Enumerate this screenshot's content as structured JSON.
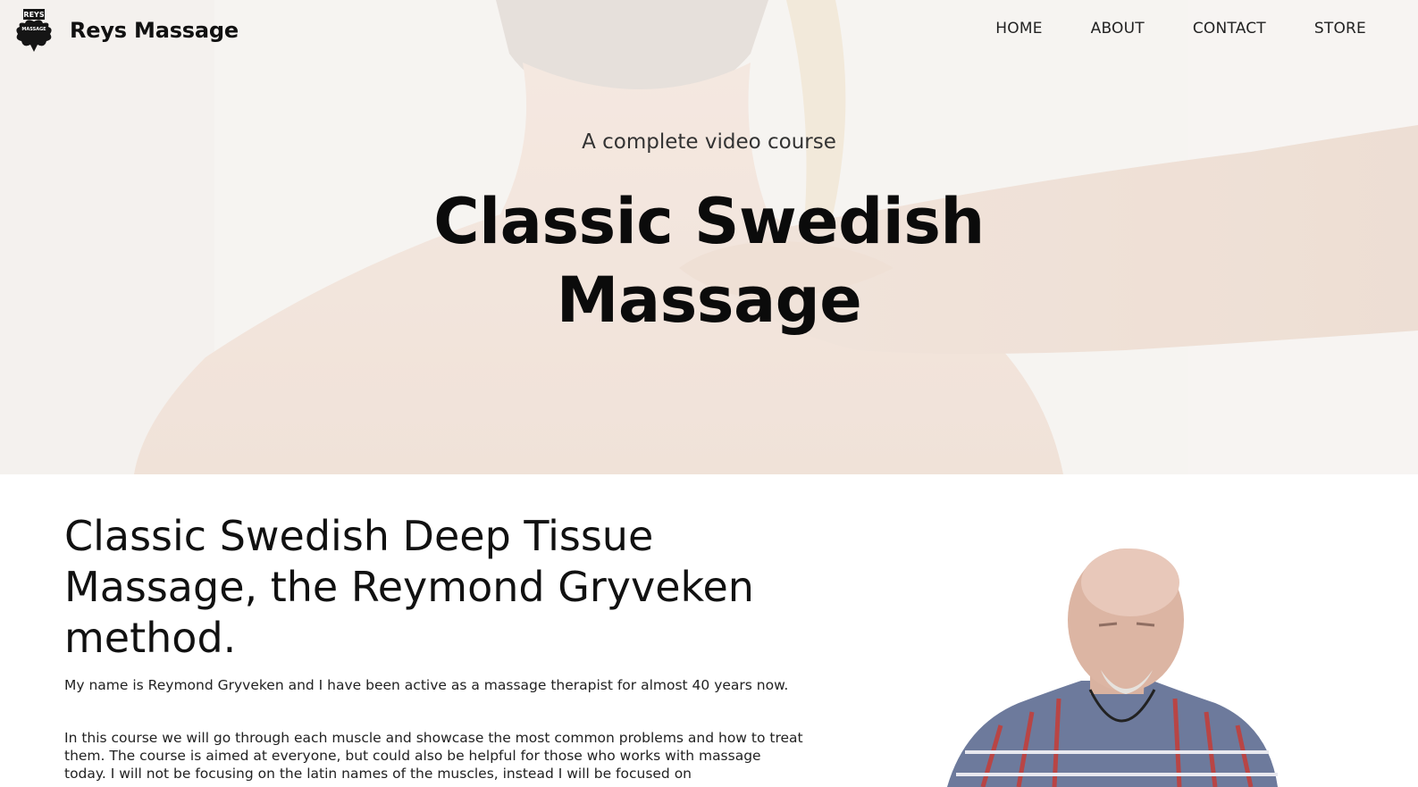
{
  "header": {
    "brand_name": "Reys Massage",
    "logo_top_text": "REYS",
    "logo_bottom_text": "MASSAGE",
    "nav": [
      {
        "label": "HOME"
      },
      {
        "label": "ABOUT"
      },
      {
        "label": "CONTACT"
      },
      {
        "label": "STORE"
      }
    ]
  },
  "hero": {
    "subtitle": "A complete video course",
    "title_line1": "Classic Swedish",
    "title_line2": "Massage",
    "image": "massage-hands-on-neck-photo"
  },
  "main": {
    "heading": "Classic Swedish Deep Tissue Massage, the Reymond Gryveken method.",
    "paragraph1": "My name is Reymond Gryveken and I have been active as a massage therapist for almost 40 years now.",
    "paragraph2": "In this course we will go through each muscle and showcase the most common problems and how to treat them. The course is aimed at everyone, but could also be helpful for those who works with massage today. I will not be focusing on the latin names of the muscles, instead I will be focused on",
    "portrait": "instructor-portrait"
  },
  "colors": {
    "text": "#111111",
    "hero_bg": "#efe9e4",
    "page_bg": "#ffffff"
  }
}
